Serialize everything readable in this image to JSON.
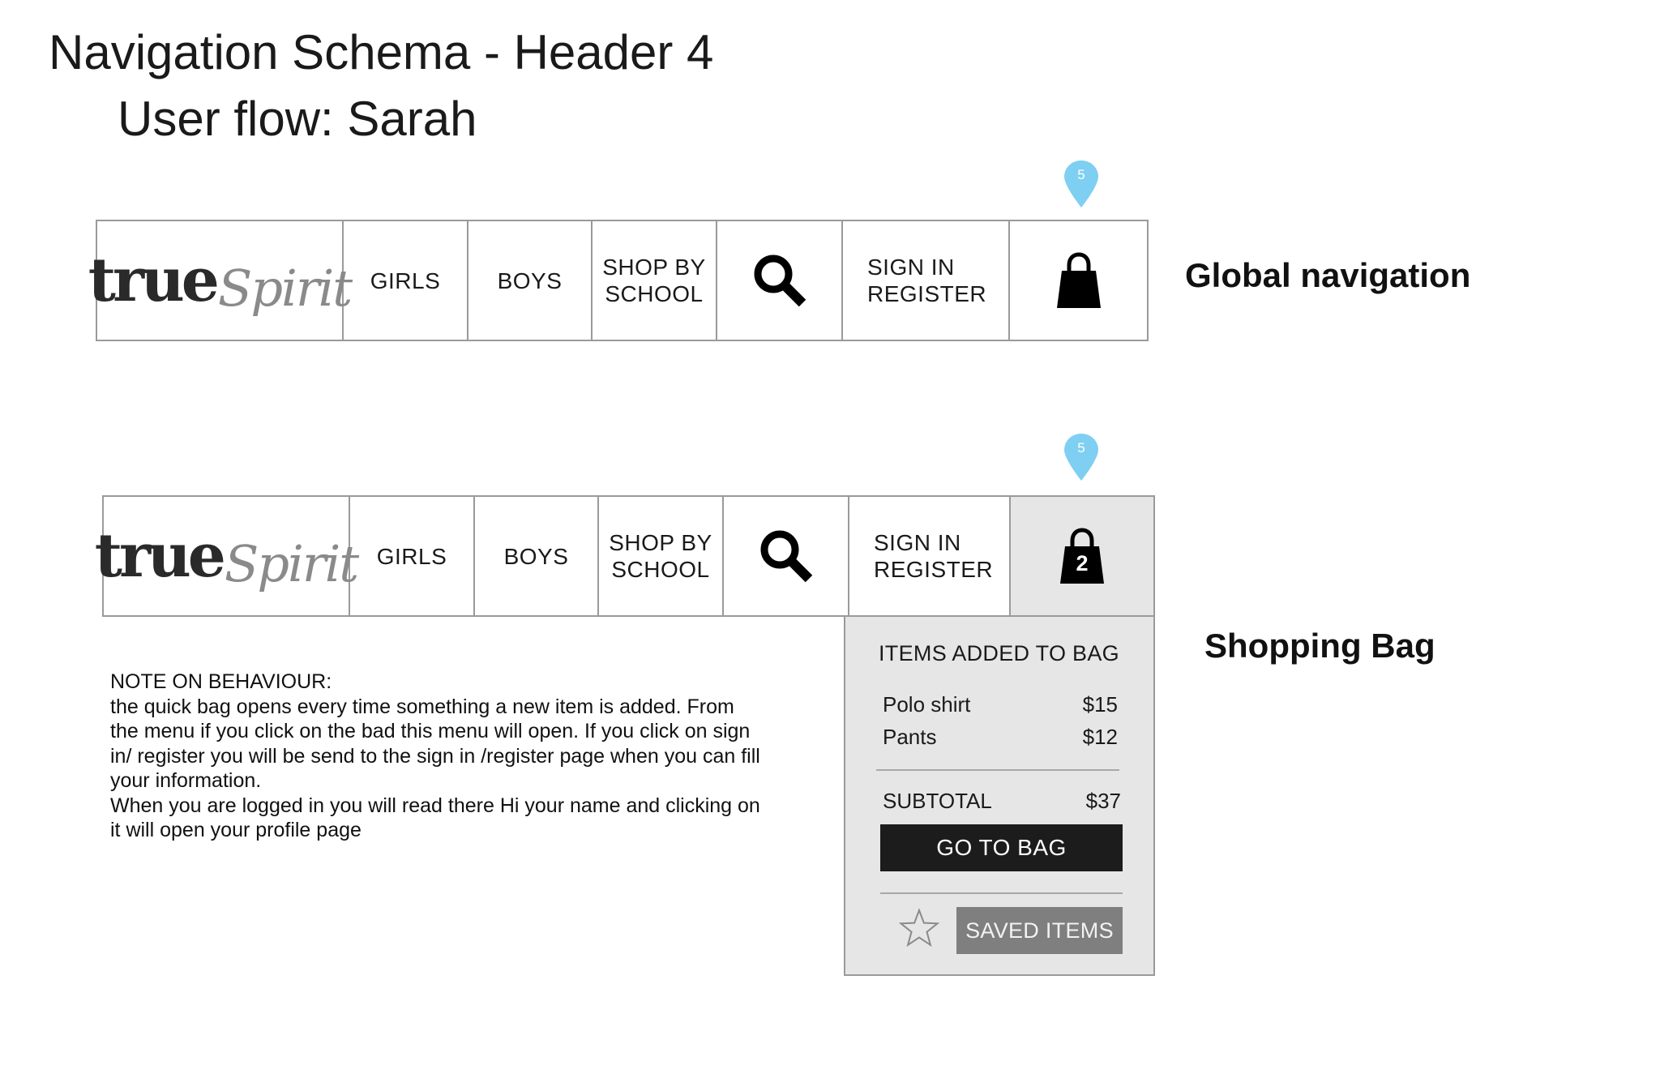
{
  "header": {
    "title": "Navigation Schema - Header 4",
    "subtitle": "User flow: Sarah"
  },
  "nav": {
    "logo_bold": "true",
    "logo_script": "Spirit",
    "girls": "GIRLS",
    "boys": "BOYS",
    "shop_by_school_1": "SHOP BY",
    "shop_by_school_2": "SCHOOL",
    "sign_in": "SIGN IN",
    "register": "REGISTER",
    "search_icon": "search-icon",
    "bag_icon": "shopping-bag-icon"
  },
  "markers": {
    "pin_label": "5",
    "pin_color": "#7ecff2"
  },
  "labels": {
    "global_navigation": "Global navigation",
    "shopping_bag": "Shopping Bag"
  },
  "bag": {
    "count": "2",
    "heading": "ITEMS ADDED TO BAG",
    "items": [
      {
        "name": "Polo shirt",
        "price": "$15"
      },
      {
        "name": "Pants",
        "price": "$12"
      }
    ],
    "subtotal_label": "SUBTOTAL",
    "subtotal_value": "$37",
    "go_to_bag": "GO TO BAG",
    "saved_items": "SAVED ITEMS",
    "star_icon": "star-icon"
  },
  "note": {
    "heading": "NOTE ON BEHAVIOUR:",
    "line1": "the quick bag opens every time something a new item is added. From",
    "line2": "the menu if you click on the bad this menu will open. If you click on sign",
    "line3": "in/ register you will be send to the sign in /register page when you can fill",
    "line4": "your information.",
    "line5": "When you are logged in you will read there Hi your name and clicking on",
    "line6": "it will open your profile page"
  }
}
